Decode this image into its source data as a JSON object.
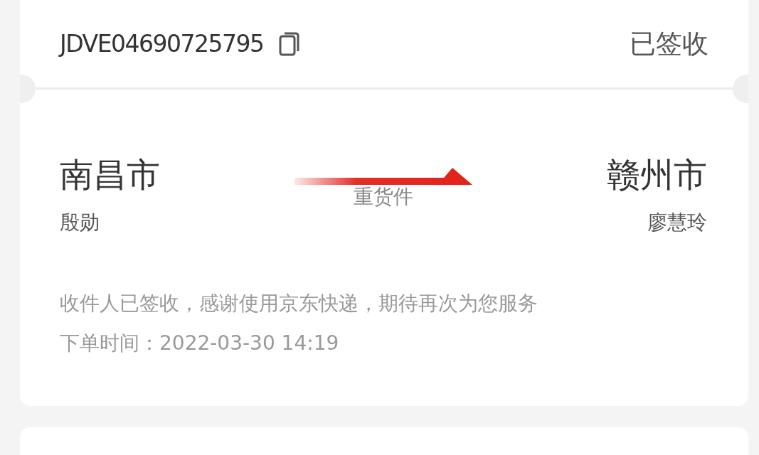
{
  "waybill": {
    "number": "JDVE04690725795",
    "status": "已签收"
  },
  "route": {
    "from": {
      "city": "南昌市",
      "name": "殷勋"
    },
    "to": {
      "city": "赣州市",
      "name": "廖慧玲"
    },
    "service": "重货件"
  },
  "message": "收件人已签收，感谢使用京东快递，期待再次为您服务",
  "order_time": "下单时间：2022-03-30 14:19"
}
